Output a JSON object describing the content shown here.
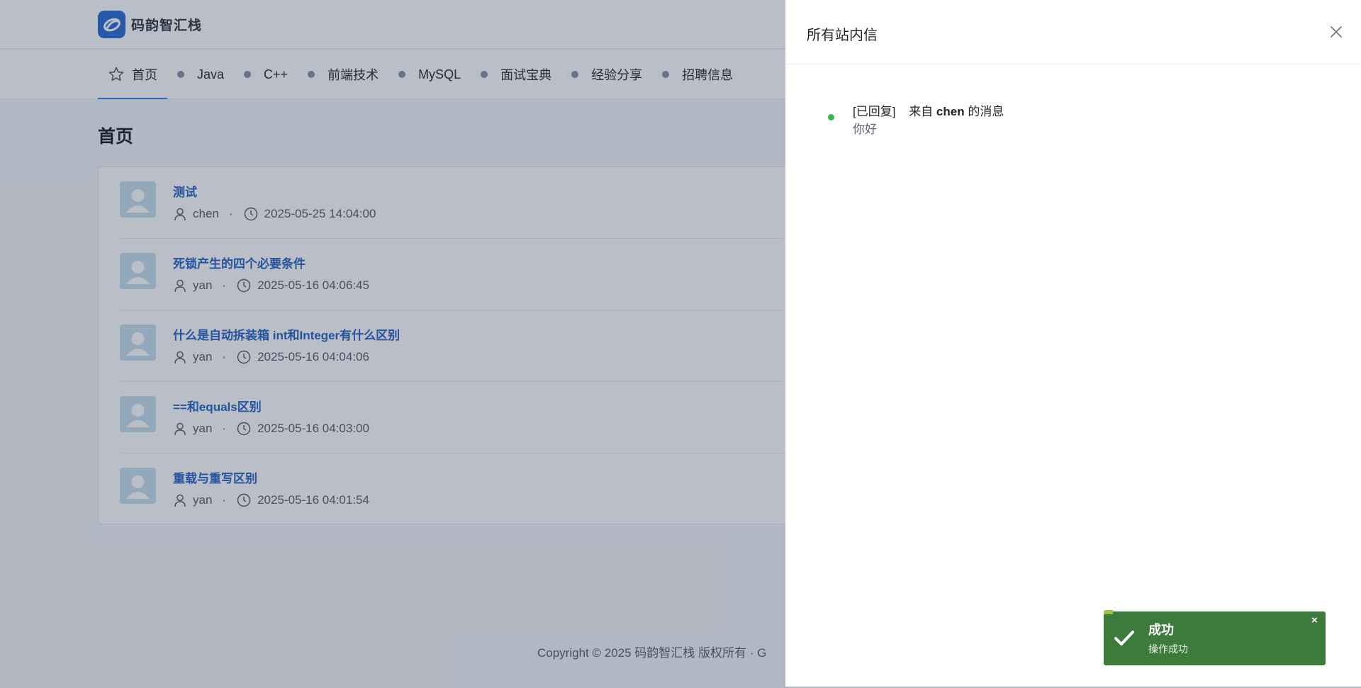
{
  "header": {
    "logo_text": "码韵智汇栈",
    "logo_icon": "logo-mark-icon"
  },
  "nav": {
    "items": [
      {
        "label": "首页",
        "icon": "star-icon",
        "active": true
      },
      {
        "label": "Java"
      },
      {
        "label": "C++"
      },
      {
        "label": "前端技术"
      },
      {
        "label": "MySQL"
      },
      {
        "label": "面试宝典"
      },
      {
        "label": "经验分享"
      },
      {
        "label": "招聘信息"
      }
    ]
  },
  "main": {
    "page_title": "首页",
    "articles": [
      {
        "title": "测试",
        "author": "chen",
        "time": "2025-05-25 14:04:00"
      },
      {
        "title": "死锁产生的四个必要条件",
        "author": "yan",
        "time": "2025-05-16 04:06:45"
      },
      {
        "title": "什么是自动拆装箱 int和Integer有什么区别",
        "author": "yan",
        "time": "2025-05-16 04:04:06"
      },
      {
        "title": "==和equals区别",
        "author": "yan",
        "time": "2025-05-16 04:03:00"
      },
      {
        "title": "重载与重写区别",
        "author": "yan",
        "time": "2025-05-16 04:01:54"
      }
    ],
    "meta_separator": "·"
  },
  "footer": {
    "text": "Copyright © 2025 码韵智汇栈 版权所有  ·  G"
  },
  "drawer": {
    "title": "所有站内信",
    "messages": [
      {
        "status": "[已回复]",
        "from_prefix": "来自",
        "from_user": "chen",
        "from_suffix": "的消息",
        "content": "你好"
      }
    ]
  },
  "toast": {
    "title": "成功",
    "message": "操作成功",
    "close_label": "×",
    "progress_percent": 4
  },
  "colors": {
    "accent": "#3b82f6",
    "link": "#2b66c4",
    "status_dot": "#3cb548",
    "toast_bg": "#3d7b3d",
    "toast_progress": "#9bc53d"
  }
}
